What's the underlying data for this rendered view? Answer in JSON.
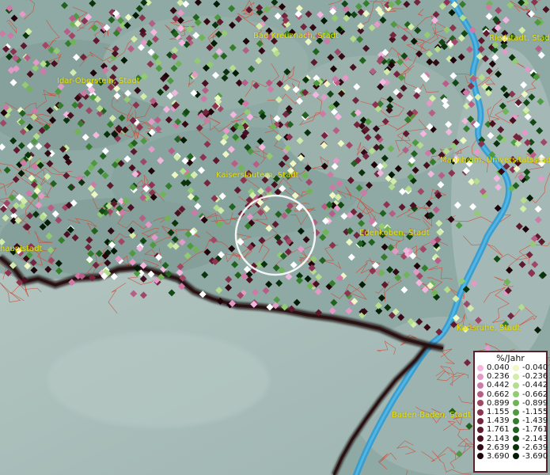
{
  "map": {
    "labels": [
      {
        "text": "Bad Kreuznach, Stadt"
      },
      {
        "text": "Riedstadt, Stadt"
      },
      {
        "text": "Idar-Oberstein, Stadt"
      },
      {
        "text": "Kaiserslautern, Stadt"
      },
      {
        "text": "Mannheim, Universitätsstadt"
      },
      {
        "text": "Edenkoben, Stadt"
      },
      {
        "text": "haupistadt"
      },
      {
        "text": "Karlsruhe, Stadt"
      },
      {
        "text": "Baden-Baden, Stadt"
      }
    ]
  },
  "legend": {
    "title": "%/Jahr",
    "positive": [
      {
        "value": "0.040",
        "color": "#f3b7df"
      },
      {
        "value": "0.236",
        "color": "#e39ac6"
      },
      {
        "value": "0.442",
        "color": "#cf7aa6"
      },
      {
        "value": "0.662",
        "color": "#b85d85"
      },
      {
        "value": "0.899",
        "color": "#a04766"
      },
      {
        "value": "1.155",
        "color": "#8a3450"
      },
      {
        "value": "1.439",
        "color": "#74253d"
      },
      {
        "value": "1.761",
        "color": "#5e192d"
      },
      {
        "value": "2.143",
        "color": "#49101f"
      },
      {
        "value": "2.639",
        "color": "#340914"
      },
      {
        "value": "3.690",
        "color": "#1f040a"
      }
    ],
    "negative": [
      {
        "value": "-0.040",
        "color": "#eef8c4"
      },
      {
        "value": "-0.236",
        "color": "#d2ecaa"
      },
      {
        "value": "-0.442",
        "color": "#b4dd8e"
      },
      {
        "value": "-0.662",
        "color": "#93cb72"
      },
      {
        "value": "-0.899",
        "color": "#70b457"
      },
      {
        "value": "-1.155",
        "color": "#4f9a40"
      },
      {
        "value": "-1.439",
        "color": "#347d2d"
      },
      {
        "value": "-1.761",
        "color": "#21621f"
      },
      {
        "value": "-2.143",
        "color": "#134814"
      },
      {
        "value": "-2.639",
        "color": "#0a320b"
      },
      {
        "value": "-3.690",
        "color": "#041c05"
      }
    ]
  },
  "colors": {
    "background": "#8fa9a4",
    "plain": "#a7bcb8",
    "boundaries": "#d8442e",
    "river": "#2f9ad2",
    "border": "#1a0a0a",
    "label": "#e8e000",
    "highlight_circle": "#ffffff"
  }
}
